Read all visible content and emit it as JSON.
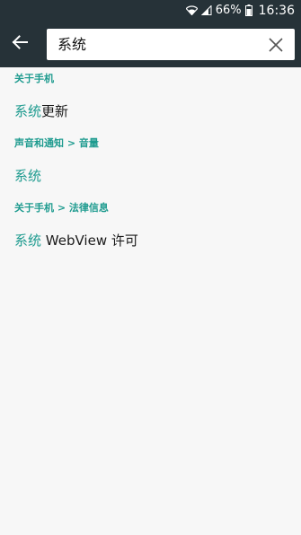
{
  "status_bar": {
    "battery_percent": "66%",
    "time": "16:36",
    "icons": [
      "wifi-icon",
      "signal-icon",
      "battery-icon"
    ]
  },
  "search": {
    "query": "系统"
  },
  "results": [
    {
      "section": "关于手机",
      "match": "系统",
      "rest": "更新"
    },
    {
      "section": "声音和通知 > 音量",
      "match": "系统",
      "rest": ""
    },
    {
      "section": "关于手机 > 法律信息",
      "match": "系统",
      "rest": " WebView 许可"
    }
  ],
  "colors": {
    "header_bg": "#263238",
    "accent": "#1e9b8f",
    "page_bg": "#f7f7f7"
  }
}
